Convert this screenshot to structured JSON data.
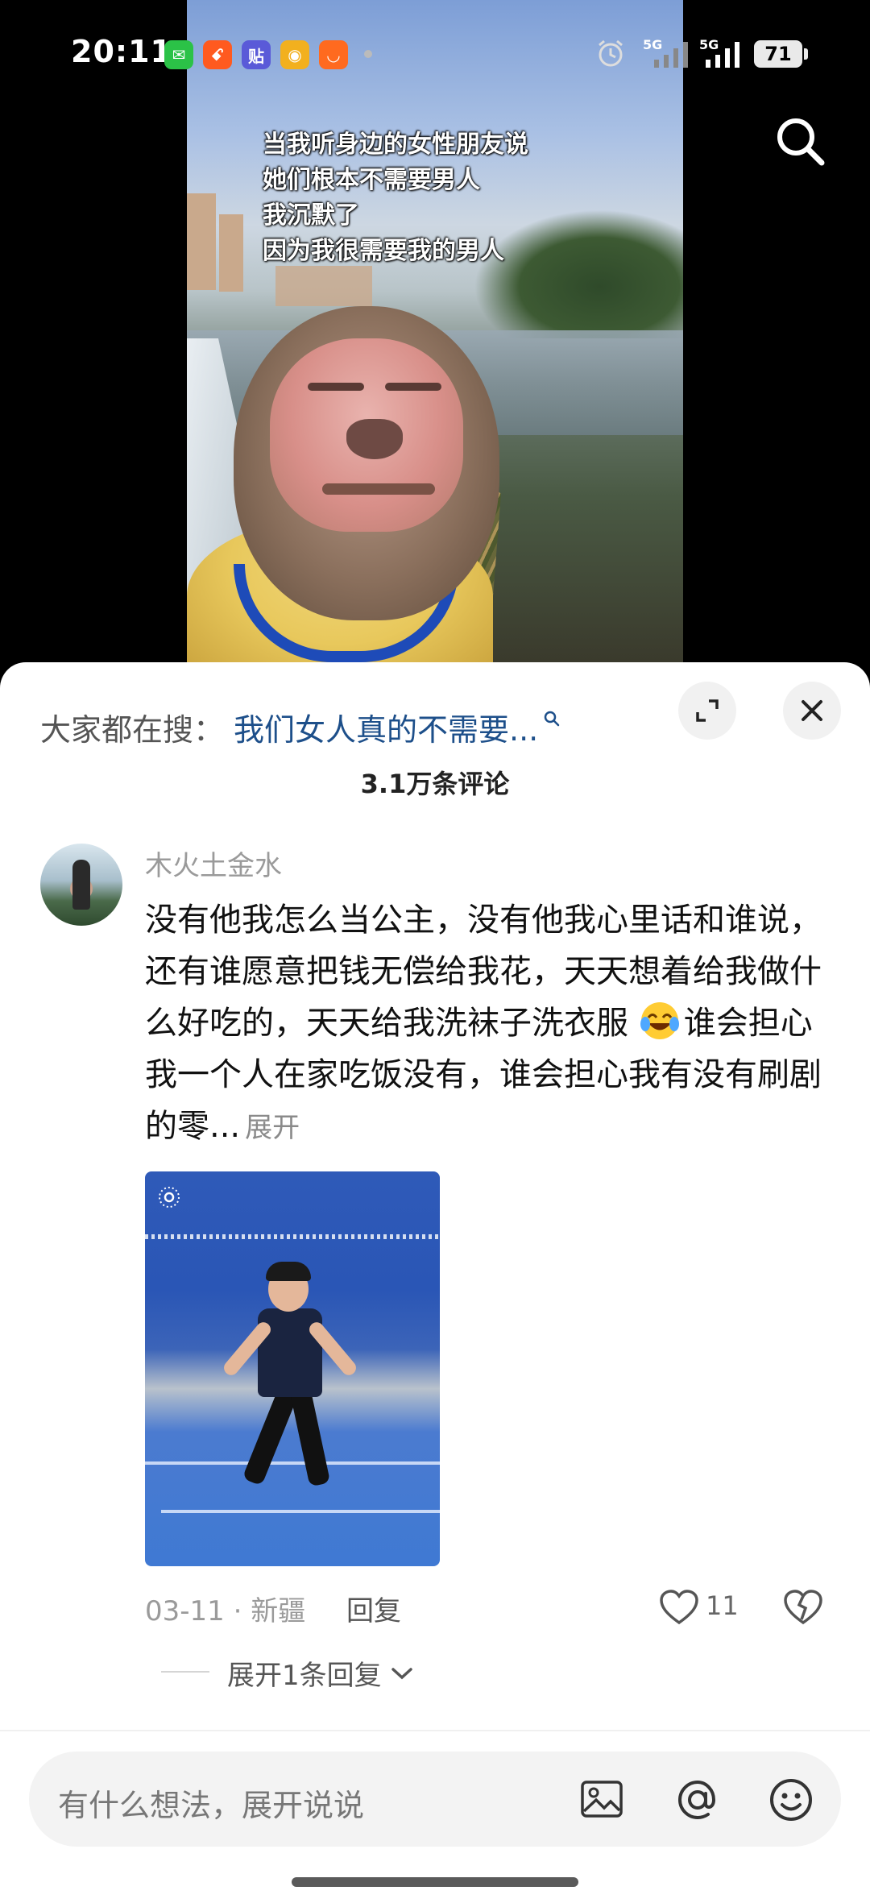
{
  "status_bar": {
    "time": "20:11",
    "app_icons": [
      {
        "name": "wechat-icon",
        "color": "#2bc247",
        "glyph": "✉"
      },
      {
        "name": "xiaohongshu-like-icon",
        "color": "#ff5a1f",
        "glyph": "ꗃ"
      },
      {
        "name": "tieba-icon",
        "color": "#5a5ad8",
        "glyph": "贴"
      },
      {
        "name": "weibo-icon",
        "color": "#f2b01e",
        "glyph": "◉"
      },
      {
        "name": "taobao-like-icon",
        "color": "#ff6a1f",
        "glyph": "◡"
      }
    ],
    "signal1_label": "5G",
    "signal2_label": "5G",
    "battery": "71"
  },
  "video": {
    "caption_lines": [
      "当我听身边的女性朋友说",
      "她们根本不需要男人",
      "我沉默了",
      "因为我很需要我的男人"
    ]
  },
  "sheet": {
    "search_prefix": "大家都在搜：",
    "search_suggestion": "我们女人真的不需要...",
    "comment_count": "3.1万条评论",
    "comment": {
      "username": "木火土金水",
      "text_part1": "没有他我怎么当公主，没有他我心里话和谁说，还有谁愿意把钱无偿给我花，天天想着给我做什么好吃的，天天给我洗袜子洗衣服",
      "text_part2": "谁会担心我一个人在家吃饭没有，谁会担心我有没有刷剧的零...",
      "expand": "展开",
      "date_location": "03-11 · 新疆",
      "reply": "回复",
      "likes": "11",
      "replies_toggle": "展开1条回复"
    },
    "input_placeholder": "有什么想法，展开说说"
  }
}
